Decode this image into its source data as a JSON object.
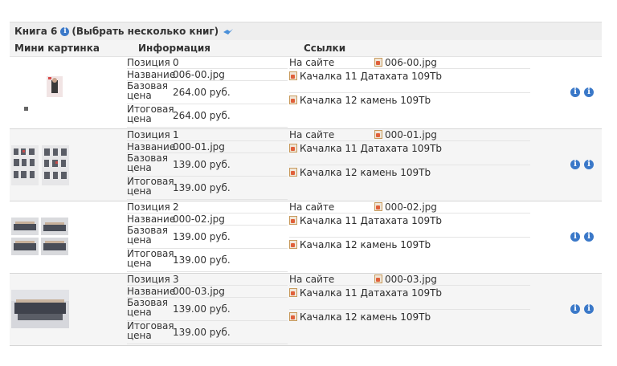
{
  "header": {
    "title": "Книга 6",
    "select_label": "(Выбрать несколько книг)"
  },
  "columns": {
    "thumb": "Мини картинка",
    "info": "Информация",
    "links": "Ссылки"
  },
  "labels": {
    "position": "Позиция",
    "name": "Название",
    "base_price": "Базовая цена",
    "final_price": "Итоговая цена",
    "on_site": "На сайте"
  },
  "records": [
    {
      "position": "0",
      "name": "006-00.jpg",
      "base_price": "264.00 руб.",
      "final_price": "264.00 руб.",
      "site_file": "006-00.jpg",
      "link1": "Качалка 11 Датахата 109Tb",
      "link2": "Качалка 12 камень 109Tb"
    },
    {
      "position": "1",
      "name": "000-01.jpg",
      "base_price": "139.00 руб.",
      "final_price": "139.00 руб.",
      "site_file": "000-01.jpg",
      "link1": "Качалка 11 Датахата 109Tb",
      "link2": "Качалка 12 камень 109Tb"
    },
    {
      "position": "2",
      "name": "000-02.jpg",
      "base_price": "139.00 руб.",
      "final_price": "139.00 руб.",
      "site_file": "000-02.jpg",
      "link1": "Качалка 11 Датахата 109Tb",
      "link2": "Качалка 12 камень 109Tb"
    },
    {
      "position": "3",
      "name": "000-03.jpg",
      "base_price": "139.00 руб.",
      "final_price": "139.00 руб.",
      "site_file": "000-03.jpg",
      "link1": "Качалка 11 Датахата 109Tb",
      "link2": "Качалка 12 камень 109Tb"
    }
  ],
  "icons": {
    "info": "info-icon",
    "select": "return-arrow-icon",
    "file": "image-file-icon"
  },
  "colors": {
    "accent": "#3a78c8",
    "row_alt": "#f5f5f5",
    "header_bg": "#eeeeee"
  }
}
